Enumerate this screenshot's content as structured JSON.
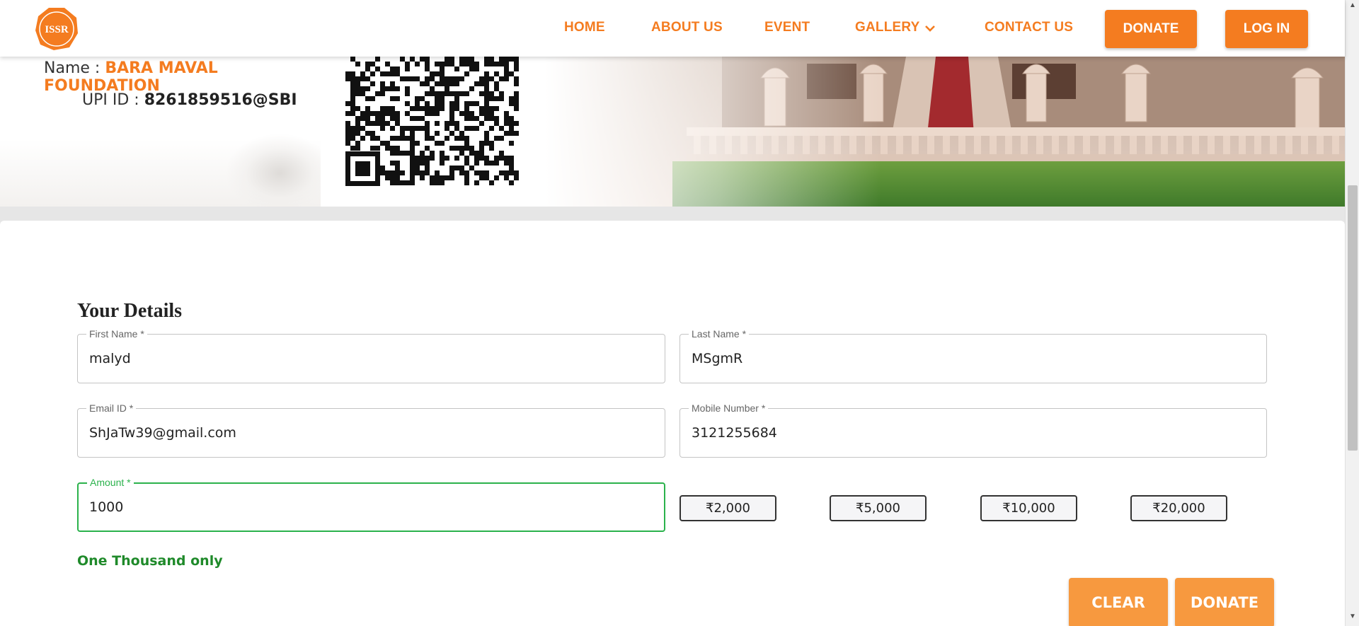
{
  "header": {
    "logo_text": "ISSR",
    "nav": [
      {
        "label": "HOME"
      },
      {
        "label": "ABOUT US"
      },
      {
        "label": "EVENT"
      },
      {
        "label": "GALLERY"
      },
      {
        "label": "CONTACT US"
      }
    ],
    "donate_label": "DONATE",
    "login_label": "LOG IN",
    "gallery_icon": "chevron-down-icon"
  },
  "banner": {
    "name_label": "Name : ",
    "name_value": "BARA MAVAL FOUNDATION",
    "upi_label": "UPI ID : ",
    "upi_value": "8261859516@SBI"
  },
  "form": {
    "title": "Your Details",
    "first_name": {
      "label": "First Name *",
      "value": "malyd"
    },
    "last_name": {
      "label": "Last Name *",
      "value": "MSgmR"
    },
    "email": {
      "label": "Email ID *",
      "value": "ShJaTw39@gmail.com"
    },
    "mobile": {
      "label": "Mobile Number *",
      "value": "3121255684"
    },
    "amount": {
      "label": "Amount *",
      "value": "1000"
    },
    "amount_words": "One Thousand only",
    "presets": [
      "₹2,000",
      "₹5,000",
      "₹10,000",
      "₹20,000"
    ],
    "clear_label": "CLEAR",
    "donate_label": "DONATE"
  },
  "colors": {
    "accent": "#f47c20",
    "button_light": "#f7993f",
    "focus_green": "#2bb24c",
    "words_green": "#1f8a2a"
  }
}
